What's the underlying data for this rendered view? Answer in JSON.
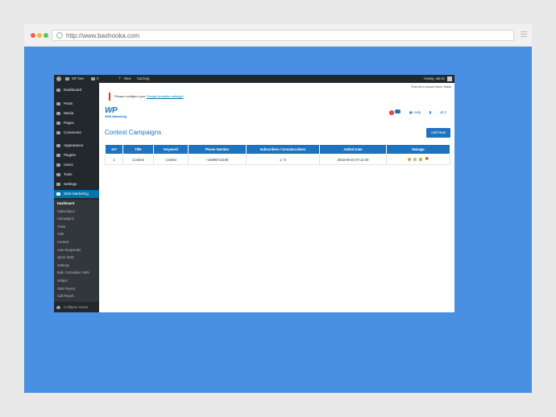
{
  "browser": {
    "url": "http://www.bashooka.com"
  },
  "adminbar": {
    "site_name": "WP Dev",
    "comments_count": "0",
    "new_label": "New",
    "caching_label": "Caching",
    "greeting": "Howdy, admin"
  },
  "sidebar": {
    "items": [
      {
        "label": "Dashboard",
        "icon": "dashboard-icon"
      },
      {
        "label": "Posts",
        "icon": "pin-icon"
      },
      {
        "label": "Media",
        "icon": "media-icon"
      },
      {
        "label": "Pages",
        "icon": "page-icon"
      },
      {
        "label": "Comments",
        "icon": "comment-icon"
      },
      {
        "label": "Appearance",
        "icon": "brush-icon"
      },
      {
        "label": "Plugins",
        "icon": "plugin-icon"
      },
      {
        "label": "Users",
        "icon": "user-icon"
      },
      {
        "label": "Tools",
        "icon": "wrench-icon"
      },
      {
        "label": "Settings",
        "icon": "settings-icon"
      },
      {
        "label": "SMS Marketing",
        "icon": "sms-icon"
      }
    ],
    "submenu": [
      "Dashboard",
      "Subscribers",
      "Campaigns",
      "Trivia",
      "Viral",
      "Contest",
      "Auto Responder",
      "Quick SMS",
      "Settings",
      "Bulk / Scheduler SMS",
      "Widget",
      "SMS Report",
      "Call Report"
    ],
    "collapse_label": "Collapse menu"
  },
  "content": {
    "topright_text": "Find me a cocoon hover, fellow",
    "notice_prefix": "Please configure your",
    "notice_link": "Google Analytics settings!",
    "logo_mark": "WP",
    "logo_sub": "SMS Marketing",
    "badge_count": "2",
    "help_label": "Help",
    "version_label": "v8.2",
    "page_title": "Contest Campaigns",
    "add_new_label": "Add New"
  },
  "table": {
    "headers": [
      "Sr#",
      "Title",
      "Keyword",
      "Phone Number",
      "Subscribers / Unsubscribers",
      "Added Date",
      "Manage"
    ],
    "rows": [
      {
        "sr": "1",
        "title": "Contest",
        "keyword": "contest",
        "phone": "+15096712190",
        "subs": "1 / 0",
        "date": "2018-06-20 07:14:49"
      }
    ]
  },
  "colors": {
    "frame_bg": "#4a90e2",
    "wp_admin_dark": "#23282d",
    "accent_blue": "#1e73be",
    "active_menu": "#0073aa",
    "notice_red": "#dc3232"
  }
}
